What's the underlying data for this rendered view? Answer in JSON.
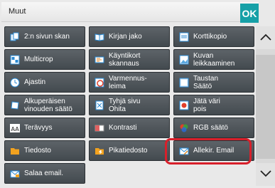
{
  "title": "Muut",
  "ok_label": "OK",
  "buttons": [
    {
      "label": "2:n sivun skan",
      "icon": "two-page-scan-icon"
    },
    {
      "label": "Kirjan jako",
      "icon": "book-divide-icon"
    },
    {
      "label": "Korttikopio",
      "icon": "card-copy-icon"
    },
    {
      "label": "Multicrop",
      "icon": "multicrop-icon"
    },
    {
      "label": "Käyntikort\nskannaus",
      "icon": "business-card-scan-icon"
    },
    {
      "label": "Kuvan\nleikkaaminen",
      "icon": "image-crop-icon"
    },
    {
      "label": "Ajastin",
      "icon": "timer-icon"
    },
    {
      "label": "Varmennus-\nleima",
      "icon": "verification-stamp-icon"
    },
    {
      "label": "Taustan\nSäätö",
      "icon": "background-adjust-icon"
    },
    {
      "label": "Alkuperäisen\nvinouden säätö",
      "icon": "skew-adjust-icon"
    },
    {
      "label": "Tyhjä sivu\nOhita",
      "icon": "blank-page-skip-icon"
    },
    {
      "label": "Jätä väri\npois",
      "icon": "color-omit-icon"
    },
    {
      "label": "Terävyys",
      "icon": "sharpness-icon"
    },
    {
      "label": "Kontrasti",
      "icon": "contrast-icon"
    },
    {
      "label": "RGB säätö",
      "icon": "rgb-adjust-icon"
    },
    {
      "label": "Tiedosto",
      "icon": "folder-icon"
    },
    {
      "label": "Pikatiedosto",
      "icon": "quick-file-icon"
    },
    {
      "label": "Allekir. Email",
      "icon": "signed-email-icon"
    },
    {
      "label": "Salaa email.",
      "icon": "encrypt-email-icon"
    }
  ],
  "highlighted_button": "Allekir. Email",
  "colors": {
    "accent": "#16a0a7",
    "highlight": "#d8202b",
    "button": "#4f555a"
  },
  "icons": {
    "scroll_up": "chevron-up-icon",
    "scroll_down": "chevron-down-icon"
  }
}
